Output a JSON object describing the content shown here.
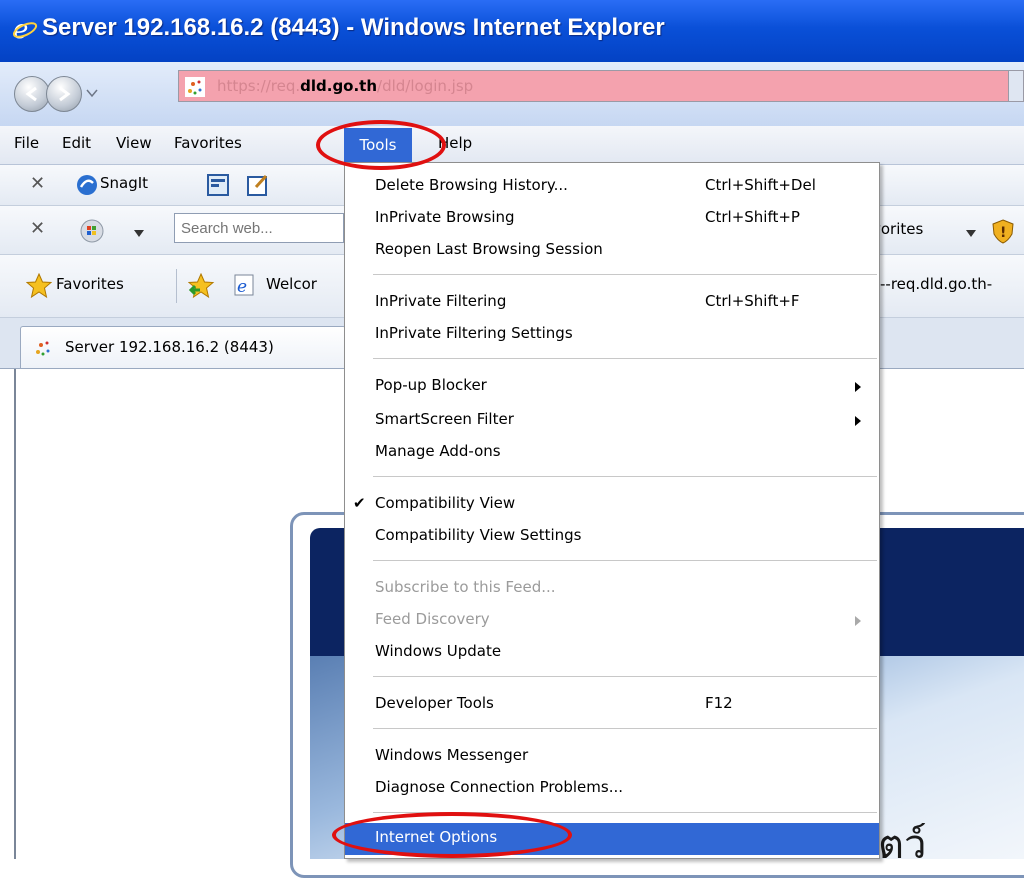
{
  "window": {
    "title": "Server 192.168.16.2 (8443) - Windows Internet Explorer"
  },
  "address": {
    "prefix": "https://req.",
    "domain": "dld.go.th",
    "path": "/dld/login.jsp"
  },
  "menubar": {
    "items": [
      "File",
      "Edit",
      "View",
      "Favorites",
      "Tools",
      "Help"
    ]
  },
  "toolbar_snagit": {
    "snagit_label": "SnagIt"
  },
  "toolbar_search": {
    "search_placeholder": "Search web...",
    "favorites_fragment": "vorites"
  },
  "toolbar_fav": {
    "favorites_label": "Favorites",
    "welcome_fragment": "Welcor",
    "site_fragment": "--req.dld.go.th-"
  },
  "tab": {
    "label": "Server 192.168.16.2 (8443)"
  },
  "tools_menu": {
    "items": [
      {
        "label": "Delete Browsing History...",
        "shortcut": "Ctrl+Shift+Del"
      },
      {
        "label": "InPrivate Browsing",
        "shortcut": "Ctrl+Shift+P"
      },
      {
        "label": "Reopen Last Browsing Session",
        "shortcut": ""
      },
      {
        "label": "InPrivate Filtering",
        "shortcut": "Ctrl+Shift+F"
      },
      {
        "label": "InPrivate Filtering Settings",
        "shortcut": ""
      },
      {
        "label": "Pop-up Blocker",
        "shortcut": ""
      },
      {
        "label": "SmartScreen Filter",
        "shortcut": ""
      },
      {
        "label": "Manage Add-ons",
        "shortcut": ""
      },
      {
        "label": "Compatibility View",
        "shortcut": ""
      },
      {
        "label": "Compatibility View Settings",
        "shortcut": ""
      },
      {
        "label": "Subscribe to this Feed...",
        "shortcut": ""
      },
      {
        "label": "Feed Discovery",
        "shortcut": ""
      },
      {
        "label": "Windows Update",
        "shortcut": ""
      },
      {
        "label": "Developer Tools",
        "shortcut": "F12"
      },
      {
        "label": "Windows Messenger",
        "shortcut": ""
      },
      {
        "label": "Diagnose Connection Problems...",
        "shortcut": ""
      },
      {
        "label": "Internet Options",
        "shortcut": ""
      }
    ]
  },
  "page": {
    "thai_fragment": "ตว์"
  },
  "colors": {
    "titlebar": "#0a50d8",
    "menu_highlight": "#3168d5",
    "annotation": "#e01010",
    "address_bg": "#f4a2ae"
  }
}
